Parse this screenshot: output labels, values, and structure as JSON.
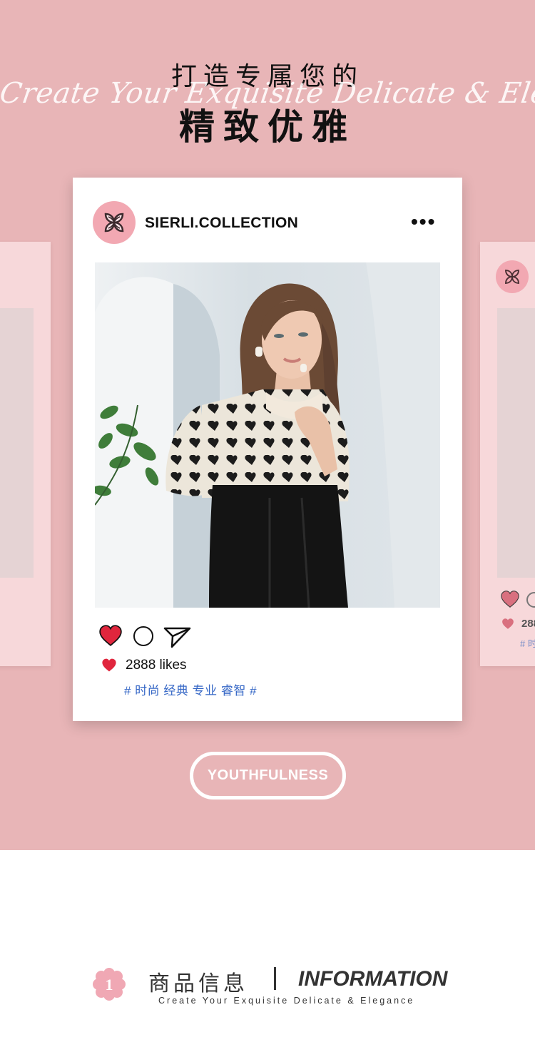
{
  "header": {
    "title_line1": "打造专属您的",
    "script_text": "Create Your Exquisite Delicate & Elegance",
    "title_line2": "精致优雅"
  },
  "post": {
    "account_name": "SIERLI.COLLECTION",
    "more_label": "•••",
    "likes_text": "2888 likes",
    "tags_text": "# 时尚 经典 专业 睿智 #",
    "liked": true
  },
  "ghost_post_right": {
    "likes_partial": "288",
    "tags_partial": "# 时"
  },
  "cta": {
    "label": "YOUTHFULNESS"
  },
  "info": {
    "badge_number": "1",
    "title_cn": "商品信息",
    "title_en": "INFORMATION",
    "subtitle": "Create Your Exquisite Delicate & Elegance"
  },
  "colors": {
    "page_bg": "#e8b5b7",
    "heart_red": "#e0263d",
    "tag_blue": "#3567c6",
    "avatar_pink": "#f2a8b2",
    "flower_pink": "#f0a8b4"
  },
  "icons": {
    "heart": "heart-icon",
    "comment": "comment-icon",
    "share": "send-icon",
    "more": "more-icon",
    "logo": "brand-logo-icon",
    "flower": "flower-badge-icon"
  }
}
